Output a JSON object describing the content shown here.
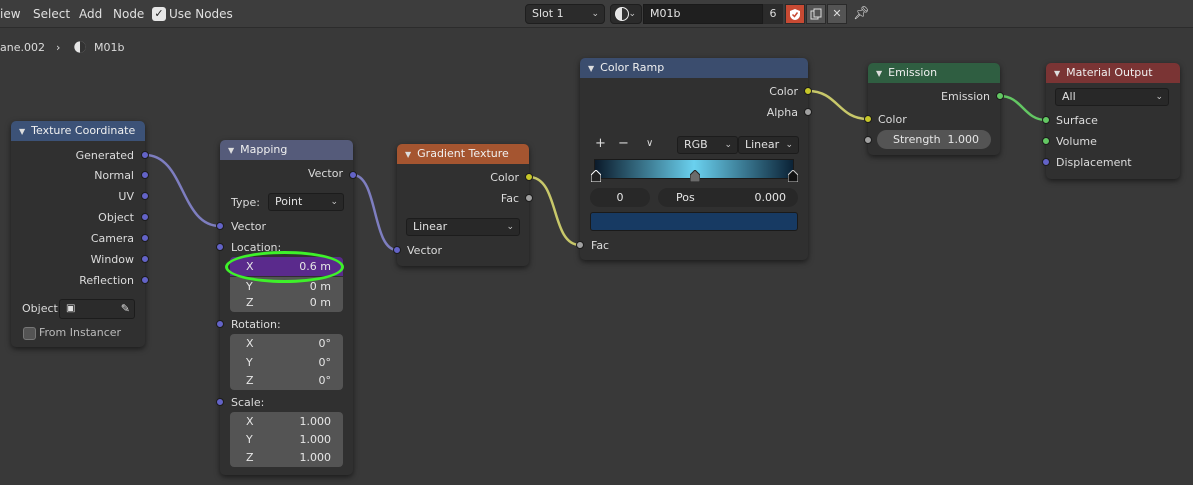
{
  "header": {
    "menu": [
      "iew",
      "Select",
      "Add",
      "Node"
    ],
    "use_nodes_label": "Use Nodes",
    "slot": "Slot 1",
    "material_name": "M01b",
    "users_count": "6"
  },
  "breadcrumb": {
    "object": "ane.002",
    "material": "M01b"
  },
  "nodes": {
    "texture_coordinate": {
      "title": "Texture Coordinate",
      "outputs": [
        "Generated",
        "Normal",
        "UV",
        "Object",
        "Camera",
        "Window",
        "Reflection"
      ],
      "object_label": "Object:",
      "from_instancer": "From Instancer"
    },
    "mapping": {
      "title": "Mapping",
      "output": "Vector",
      "type_label": "Type:",
      "type_value": "Point",
      "vector_input": "Vector",
      "location_label": "Location:",
      "location": [
        {
          "axis": "X",
          "value": "0.6 m"
        },
        {
          "axis": "Y",
          "value": "0 m"
        },
        {
          "axis": "Z",
          "value": "0 m"
        }
      ],
      "rotation_label": "Rotation:",
      "rotation": [
        {
          "axis": "X",
          "value": "0°"
        },
        {
          "axis": "Y",
          "value": "0°"
        },
        {
          "axis": "Z",
          "value": "0°"
        }
      ],
      "scale_label": "Scale:",
      "scale": [
        {
          "axis": "X",
          "value": "1.000"
        },
        {
          "axis": "Y",
          "value": "1.000"
        },
        {
          "axis": "Z",
          "value": "1.000"
        }
      ]
    },
    "gradient_texture": {
      "title": "Gradient Texture",
      "outputs": [
        "Color",
        "Fac"
      ],
      "type_value": "Linear",
      "input": "Vector"
    },
    "color_ramp": {
      "title": "Color Ramp",
      "outputs": [
        "Color",
        "Alpha"
      ],
      "add": "+",
      "remove": "−",
      "more": "∨",
      "color_mode": "RGB",
      "interpolation": "Linear",
      "index": "0",
      "pos_label": "Pos",
      "pos_value": "0.000",
      "input": "Fac",
      "swatch_color": "#173a63"
    },
    "emission": {
      "title": "Emission",
      "output": "Emission",
      "color_input": "Color",
      "strength_label": "Strength",
      "strength_value": "1.000"
    },
    "material_output": {
      "title": "Material Output",
      "target": "All",
      "inputs": [
        "Surface",
        "Volume",
        "Displacement"
      ]
    }
  },
  "colors": {
    "highlight_outline": "#3ef12a",
    "selected_field": "#5a2a8c",
    "vector_socket": "#6363c7",
    "color_socket": "#c7c729",
    "shader_socket": "#63c763"
  }
}
